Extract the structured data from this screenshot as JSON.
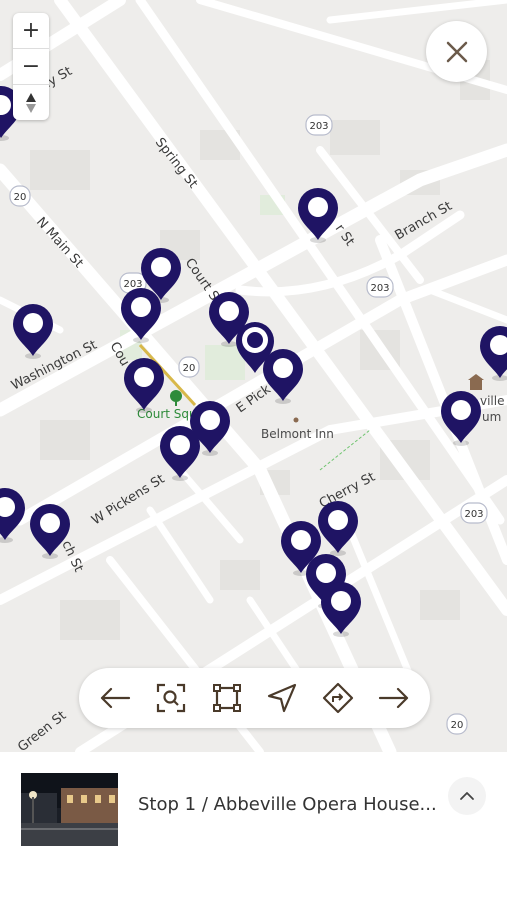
{
  "map": {
    "streets": {
      "spring": "Spring St",
      "n_main": "N Main St",
      "washington": "Washington St",
      "court_a": "Court S",
      "court_b": "Cou",
      "e_pickens": "E Pick",
      "w_pickens": "W Pickens St",
      "cherry": "Cherry St",
      "branch": "Branch St",
      "green": "Green St",
      "upper_left": "ey St",
      "church_frag": "ch St",
      "mar_frag": "r St"
    },
    "route_shields": [
      "203",
      "203",
      "203",
      "20",
      "20",
      "203",
      "20"
    ],
    "pois": {
      "belmont_inn": "Belmont Inn",
      "court_square": "Court Squ",
      "museum_a": "ville",
      "museum_b": "um"
    },
    "pin_color": "#1f1464"
  },
  "controls": {
    "zoom_in": "+",
    "zoom_out": "−",
    "compass": "compass-icon"
  },
  "toolbar": {
    "tools": [
      "arrow-left-icon",
      "zoom-search-icon",
      "fit-bounds-icon",
      "navigate-icon",
      "directions-icon",
      "arrow-right-icon"
    ]
  },
  "tour": {
    "stop_title": "Stop 1 / Abbeville Opera House..."
  }
}
